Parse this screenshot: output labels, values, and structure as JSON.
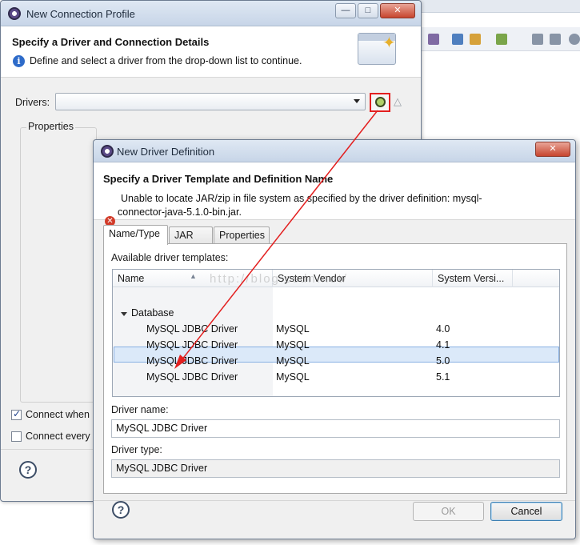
{
  "outer_dialog": {
    "title": "New Connection Profile",
    "banner_title": "Specify a Driver and Connection Details",
    "banner_message": "Define and select a driver from the drop-down list to continue.",
    "drivers_label": "Drivers:",
    "drivers_value": "",
    "properties_label": "Properties",
    "connect_when_label": "Connect when",
    "connect_every_label": "Connect every"
  },
  "inner_dialog": {
    "title": "New Driver Definition",
    "banner_title": "Specify a Driver Template and Definition Name",
    "error_line1": "Unable to locate JAR/zip in file system as specified by the driver definition: mysql-",
    "error_line2": "connector-java-5.1.0-bin.jar.",
    "tabs": [
      {
        "label": "Name/Type",
        "active": true
      },
      {
        "label": "JAR List",
        "active": false
      },
      {
        "label": "Properties",
        "active": false
      }
    ],
    "templates_label": "Available driver templates:",
    "columns": [
      "Name",
      "System Vendor",
      "System Versi..."
    ],
    "category": "Database",
    "rows": [
      {
        "name": "MySQL JDBC Driver",
        "vendor": "MySQL",
        "version": "4.0"
      },
      {
        "name": "MySQL JDBC Driver",
        "vendor": "MySQL",
        "version": "4.1"
      },
      {
        "name": "MySQL JDBC Driver",
        "vendor": "MySQL",
        "version": "5.0"
      },
      {
        "name": "MySQL JDBC Driver",
        "vendor": "MySQL",
        "version": "5.1"
      }
    ],
    "driver_name_label": "Driver name:",
    "driver_name_value": "MySQL JDBC Driver",
    "driver_type_label": "Driver type:",
    "driver_type_value": "MySQL JDBC Driver",
    "ok_label": "OK",
    "cancel_label": "Cancel"
  },
  "watermark": "http://blog.csdn.net/",
  "colors": {
    "highlight": "#e31f1f",
    "selection": "#dbe9f9"
  }
}
